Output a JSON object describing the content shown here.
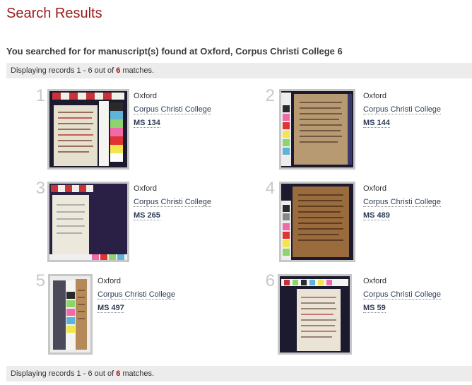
{
  "page": {
    "title": "Search Results",
    "query": "You searched for for manuscript(s) found at Oxford, Corpus Christi College 6"
  },
  "records": {
    "prefix": "Displaying records ",
    "range": "1 - 6",
    "middle": " out of ",
    "total": "6",
    "suffix": " matches."
  },
  "results": [
    {
      "number": "1",
      "city": "Oxford",
      "institution": "Corpus Christi College",
      "shelfmark": "MS 134"
    },
    {
      "number": "2",
      "city": "Oxford",
      "institution": "Corpus Christi College",
      "shelfmark": "MS 144"
    },
    {
      "number": "3",
      "city": "Oxford",
      "institution": "Corpus Christi College",
      "shelfmark": "MS 265"
    },
    {
      "number": "4",
      "city": "Oxford",
      "institution": "Corpus Christi College",
      "shelfmark": "MS 489"
    },
    {
      "number": "5",
      "city": "Oxford",
      "institution": "Corpus Christi College",
      "shelfmark": "MS 497"
    },
    {
      "number": "6",
      "city": "Oxford",
      "institution": "Corpus Christi College",
      "shelfmark": "MS 59"
    }
  ],
  "colors": {
    "title": "#9b1b1b",
    "highlight": "#a31515",
    "link": "#2d3d55",
    "records_bar": "#ececec"
  }
}
